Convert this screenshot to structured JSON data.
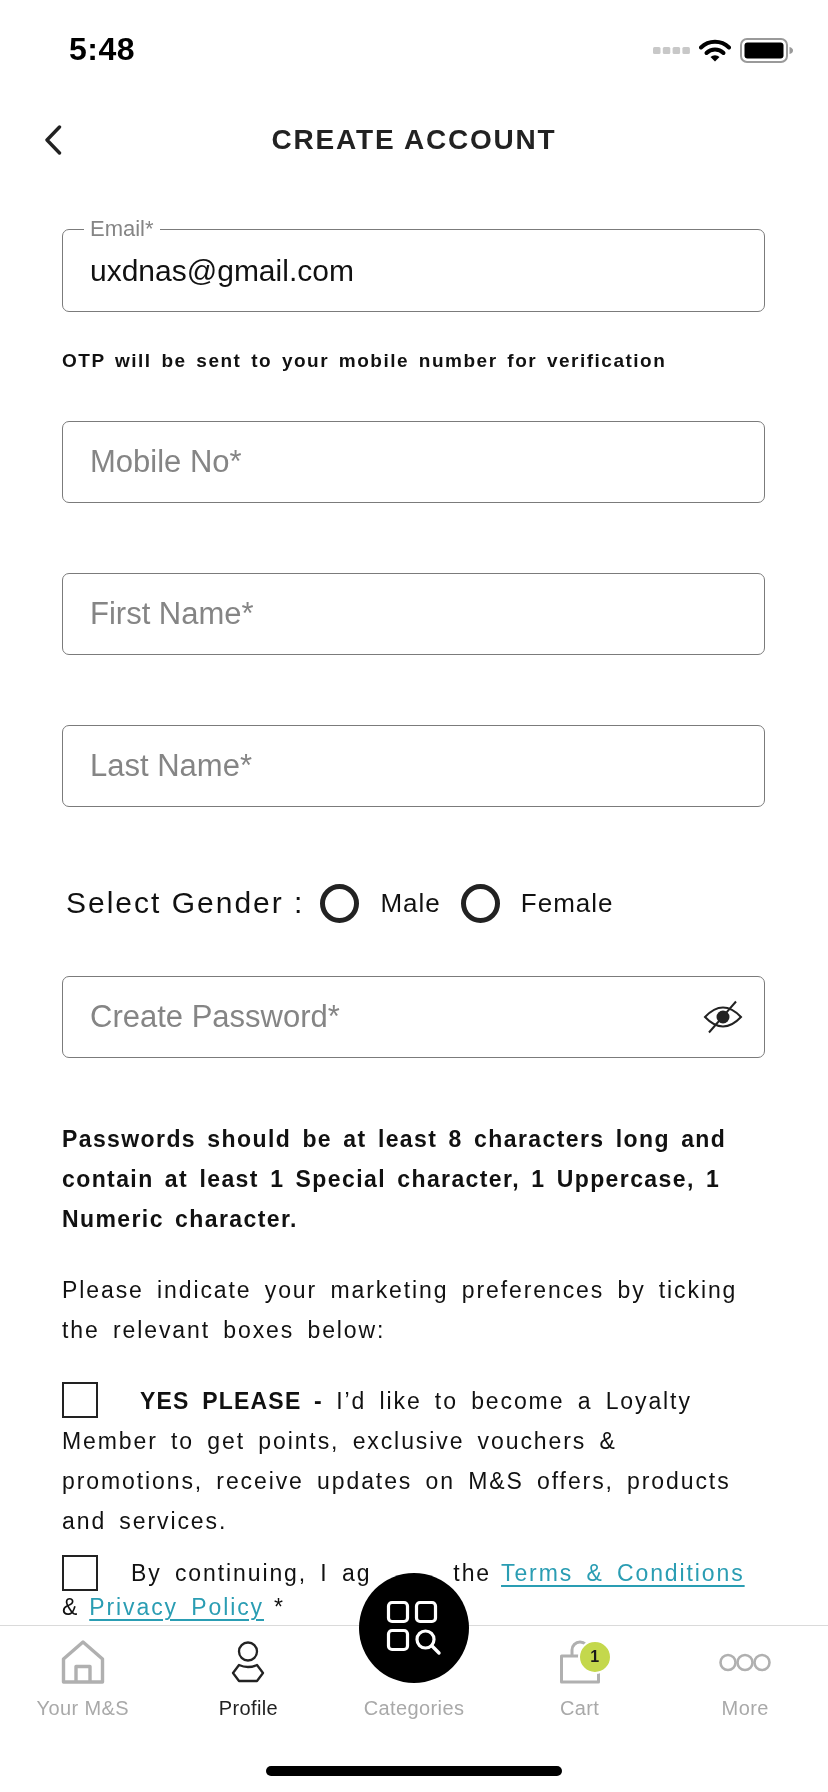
{
  "status_bar": {
    "time": "5:48"
  },
  "header": {
    "title": "CREATE ACCOUNT"
  },
  "form": {
    "email": {
      "label": "Email*",
      "value": "uxdnas@gmail.com"
    },
    "otp_note": "OTP will be sent to your mobile number for verification",
    "fields": [
      {
        "placeholder": "Mobile No*"
      },
      {
        "placeholder": "First Name*"
      },
      {
        "placeholder": "Last Name*"
      }
    ],
    "gender": {
      "label": "Select Gender :",
      "options": [
        {
          "label": "Male",
          "selected": false
        },
        {
          "label": "Female",
          "selected": false
        }
      ]
    },
    "password": {
      "placeholder": "Create Password*"
    },
    "password_rules": "Passwords should be at least 8 characters long and contain at least 1 Special character, 1 Uppercase, 1 Numeric character.",
    "marketing_intro": "Please indicate your marketing preferences by ticking the relevant boxes below:",
    "consents": [
      {
        "kind": "loyalty",
        "checked": false,
        "text": "**YES PLEASE -** I’d like to become a Loyalty Member to get points, exclusive vouchers & promotions, receive updates on M&S offers, products and services."
      },
      {
        "kind": "terms",
        "checked": false,
        "lines": [
          [
            {
              "kind": "text",
              "text": "By continuing, I ag"
            },
            {
              "kind": "text",
              "text": "the"
            },
            {
              "kind": "link",
              "text": "Terms & Conditions"
            }
          ],
          [
            {
              "kind": "text",
              "text": "&"
            },
            {
              "kind": "link",
              "text": "Privacy Policy"
            },
            {
              "kind": "text",
              "text": "*"
            }
          ]
        ]
      }
    ]
  },
  "tab_bar": {
    "items": [
      {
        "kind": "tab",
        "label": "Your M&S",
        "selected": false
      },
      {
        "kind": "tab",
        "label": "Profile",
        "selected": true
      },
      {
        "kind": "center",
        "label": "Categories",
        "selected": false
      },
      {
        "kind": "tab",
        "label": "Cart",
        "selected": false,
        "badge": "1"
      },
      {
        "kind": "tab",
        "label": "More",
        "selected": false
      }
    ]
  }
}
